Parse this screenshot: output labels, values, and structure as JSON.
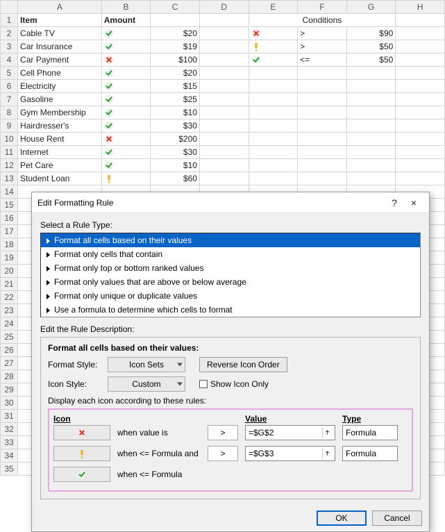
{
  "columns": [
    "",
    "A",
    "B",
    "C",
    "D",
    "E",
    "F",
    "G",
    "H"
  ],
  "header": {
    "item": "Item",
    "amount": "Amount",
    "conditions": "Conditions"
  },
  "items": [
    {
      "name": "Cable TV",
      "icon": "check",
      "amount": "$20"
    },
    {
      "name": "Car Insurance",
      "icon": "check",
      "amount": "$19"
    },
    {
      "name": "Car Payment",
      "icon": "cross",
      "amount": "$100"
    },
    {
      "name": "Cell Phone",
      "icon": "check",
      "amount": "$20"
    },
    {
      "name": "Electricity",
      "icon": "check",
      "amount": "$15"
    },
    {
      "name": "Gasoline",
      "icon": "check",
      "amount": "$25"
    },
    {
      "name": "Gym Membership",
      "icon": "check",
      "amount": "$10"
    },
    {
      "name": "Hairdresser's",
      "icon": "check",
      "amount": "$30"
    },
    {
      "name": "House Rent",
      "icon": "cross",
      "amount": "$200"
    },
    {
      "name": "Internet",
      "icon": "check",
      "amount": "$30"
    },
    {
      "name": "Pet Care",
      "icon": "check",
      "amount": "$10"
    },
    {
      "name": "Student Loan",
      "icon": "warn",
      "amount": "$60"
    }
  ],
  "conditions": [
    {
      "icon": "cross",
      "op": ">",
      "val": "$90"
    },
    {
      "icon": "warn",
      "op": ">",
      "val": "$50"
    },
    {
      "icon": "check",
      "op": "<=",
      "val": "$50"
    }
  ],
  "dialog": {
    "title": "Edit Formatting Rule",
    "help": "?",
    "close": "×",
    "select_label": "Select a Rule Type:",
    "rule_types": [
      "Format all cells based on their values",
      "Format only cells that contain",
      "Format only top or bottom ranked values",
      "Format only values that are above or below average",
      "Format only unique or duplicate values",
      "Use a formula to determine which cells to format"
    ],
    "edit_label": "Edit the Rule Description:",
    "panel_title": "Format all cells based on their values:",
    "format_style_lbl": "Format Style:",
    "format_style_val": "Icon Sets",
    "reverse": "Reverse Icon Order",
    "icon_style_lbl": "Icon Style:",
    "icon_style_val": "Custom",
    "show_icon_only": "Show Icon Only",
    "display_lbl": "Display each icon according to these rules:",
    "hdr_icon": "Icon",
    "hdr_value": "Value",
    "hdr_type": "Type",
    "rules": [
      {
        "icon": "cross",
        "text": "when value is",
        "op": ">",
        "val": "=$G$2",
        "type": "Formula"
      },
      {
        "icon": "warn",
        "text": "when <= Formula and",
        "op": ">",
        "val": "=$G$3",
        "type": "Formula"
      },
      {
        "icon": "check",
        "text": "when <= Formula"
      }
    ],
    "ok": "OK",
    "cancel": "Cancel"
  }
}
